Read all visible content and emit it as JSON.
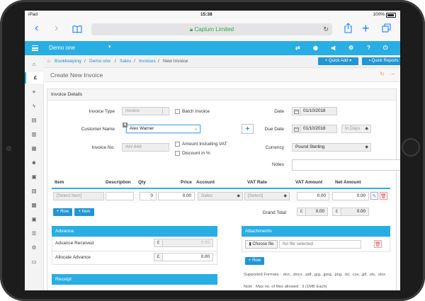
{
  "status": {
    "device": "iPad",
    "time": "15:38",
    "battery": "100%"
  },
  "browser": {
    "url_label": "Caplum Limited"
  },
  "header": {
    "company": "Demo one"
  },
  "breadcrumb": [
    "Bookkeeping",
    "Demo one",
    "Sales",
    "Invoices",
    "New Invoice"
  ],
  "buttons": {
    "quick_add": "+ Quick Add",
    "quick_reports": "Quick Reports"
  },
  "page": {
    "title": "Create New Invoice",
    "panel_title": "Invoice Details"
  },
  "form": {
    "invoice_type_label": "Invoice Type",
    "invoice_type_value": "Invoice",
    "batch_invoice_label": "Batch Invoice",
    "customer_name_label": "Customer Name",
    "customer_name_value": "Alex Warner",
    "invoice_no_label": "Invoice No.",
    "invoice_no_value": "INV-649",
    "amount_incl_vat_label": "Amount Including VAT",
    "discount_label": "Discount in %",
    "date_label": "Date",
    "date_value": "01/10/2018",
    "due_date_label": "Due Date",
    "due_date_value": "01/10/2018",
    "due_in_value": "In Days",
    "currency_label": "Currency",
    "currency_value": "Pound Sterling",
    "notes_label": "Notes"
  },
  "table": {
    "columns": [
      "Item",
      "Description",
      "Qty",
      "Price",
      "Account",
      "VAT Rate",
      "VAT Amount",
      "Net Amount"
    ],
    "row": {
      "item": "[Select Item]",
      "qty": "0",
      "price": "0.00",
      "account": "Sales",
      "vat_rate": "[Select]",
      "vat_amount": "0.00",
      "net_amount": "0.00"
    },
    "add_row": "+ Row",
    "add_item": "+ Item",
    "grand_total_label": "Grand Total",
    "currency_symbol": "£",
    "grand_total_vat": "0.00",
    "grand_total_net": "0.00"
  },
  "advance": {
    "title": "Advance",
    "received_label": "Advance Received",
    "received_value": "0.00",
    "allocate_label": "Allocate Advance",
    "allocate_value": "0.00",
    "currency_symbol": "£"
  },
  "receipt": {
    "title": "Receipt"
  },
  "attachments": {
    "title": "Attachments",
    "choose_file": "Choose file",
    "no_file": "No file selected",
    "add_row": "+ Row",
    "formats": "Supported Formats : .doc, .docx, .pdf, .jpg, .jpeg, .png, .txt, .csv, .gif, .xls, .xlsx",
    "note": "Note : Max no. of files allowed : 3 (1MB Each)"
  },
  "colors": {
    "accent": "#29aee3",
    "button": "#2196d3"
  }
}
